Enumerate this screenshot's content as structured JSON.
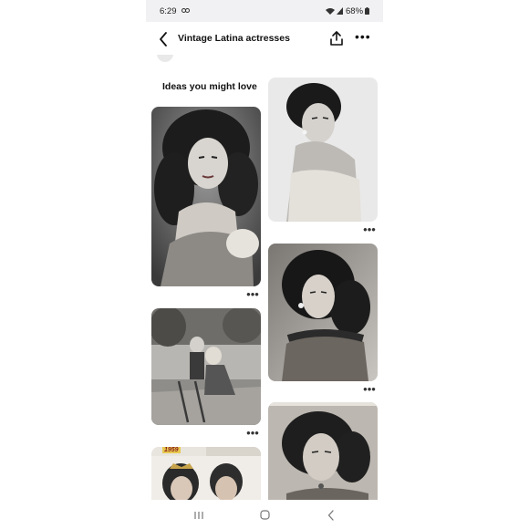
{
  "status_bar": {
    "time": "6:29",
    "battery": "68%"
  },
  "header": {
    "title": "Vintage Latina actresses"
  },
  "section": {
    "title": "Ideas you might love"
  },
  "pins": [
    {
      "id": "pin-1",
      "more": "•••"
    },
    {
      "id": "pin-2",
      "more": "•••"
    },
    {
      "id": "pin-3",
      "more": "•••"
    },
    {
      "id": "pin-4",
      "more": "•••"
    },
    {
      "id": "pin-5",
      "more": "•••"
    },
    {
      "id": "pin-6",
      "more": "•••"
    }
  ],
  "pin_6_badge": "1959",
  "header_more": "•••",
  "icons": {
    "back": "chevron-left-icon",
    "share": "share-icon",
    "more": "more-dots-icon",
    "nav_recents": "recents-icon",
    "nav_home": "home-icon",
    "nav_back": "back-nav-icon"
  },
  "colors": {
    "background": "#ffffff",
    "status_bar": "#f1f1f3",
    "text": "#111111"
  }
}
